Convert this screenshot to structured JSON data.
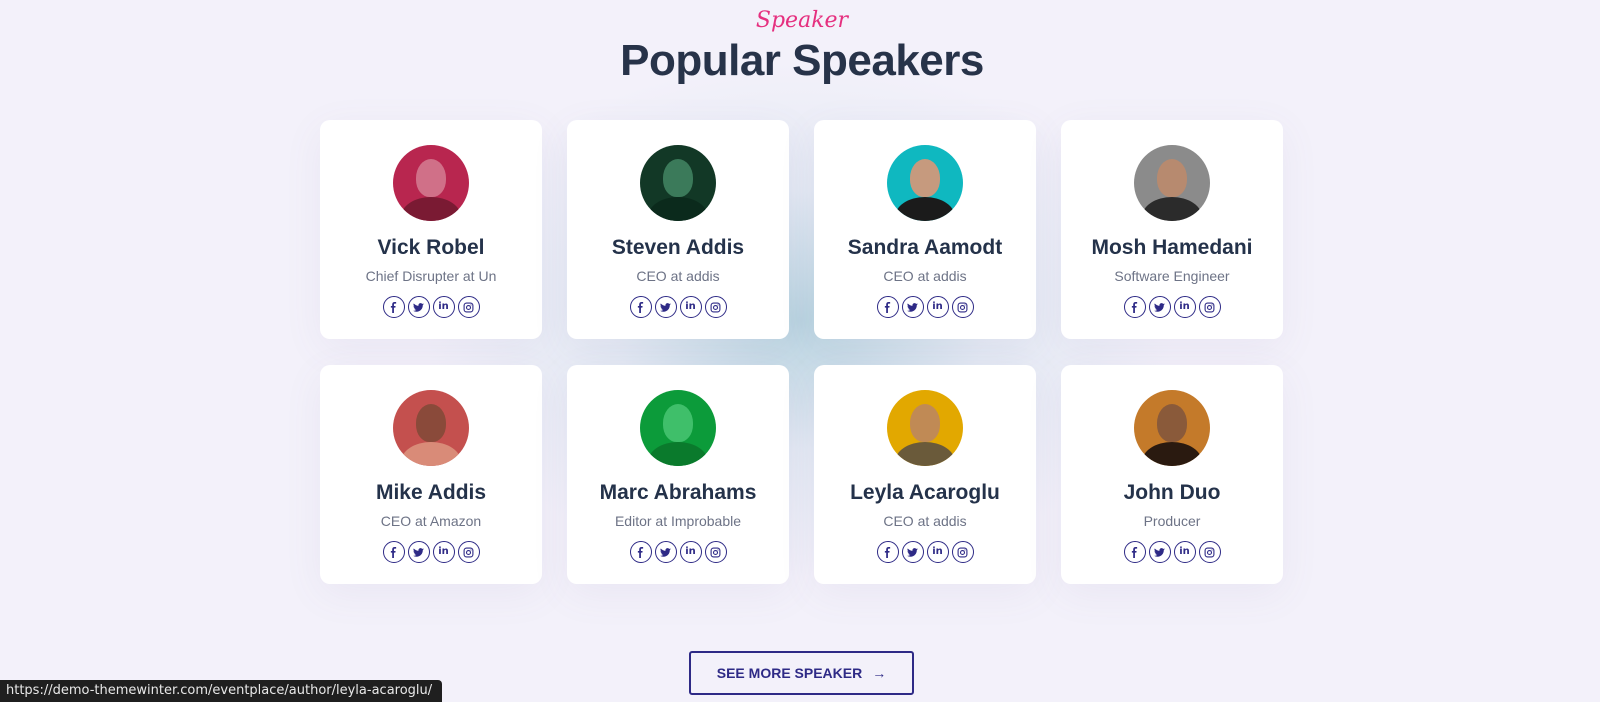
{
  "header": {
    "kicker": "Speaker",
    "title": "Popular Speakers"
  },
  "speakers": [
    {
      "name": "Vick Robel",
      "role": "Chief Disrupter at Un",
      "bg": "#b8264f",
      "skin": "#d07088",
      "shirt": "#7a1a33"
    },
    {
      "name": "Steven Addis",
      "role": "CEO at addis",
      "bg": "#123826",
      "skin": "#3b7a5a",
      "shirt": "#0b2a1c"
    },
    {
      "name": "Sandra Aamodt",
      "role": "CEO at addis",
      "bg": "#0fb8c0",
      "skin": "#c69a7e",
      "shirt": "#1b1b1b"
    },
    {
      "name": "Mosh Hamedani",
      "role": "Software Engineer",
      "bg": "#8b8b8b",
      "skin": "#b78a6f",
      "shirt": "#2b2b2b"
    },
    {
      "name": "Mike Addis",
      "role": "CEO at Amazon",
      "bg": "#c4504e",
      "skin": "#8a4a3a",
      "shirt": "#d98b78"
    },
    {
      "name": "Marc Abrahams",
      "role": "Editor at Improbable",
      "bg": "#0c9b3a",
      "skin": "#3fbf6a",
      "shirt": "#0a7a2c"
    },
    {
      "name": "Leyla Acaroglu",
      "role": "CEO at addis",
      "bg": "#e2a800",
      "skin": "#c08a55",
      "shirt": "#6a5a3a"
    },
    {
      "name": "John Duo",
      "role": "Producer",
      "bg": "#c47a2a",
      "skin": "#8a5a3a",
      "shirt": "#2a1a10"
    }
  ],
  "social_icons": [
    "facebook-icon",
    "twitter-icon",
    "linkedin-icon",
    "instagram-icon"
  ],
  "cta": {
    "label": "SEE MORE SPEAKER",
    "arrow": "→"
  },
  "status_bar": {
    "url": "https://demo-themewinter.com/eventplace/author/leyla-acaroglu/"
  },
  "colors": {
    "accent_pink": "#e5307f",
    "brand_navy": "#2e2a86",
    "title": "#273349"
  }
}
